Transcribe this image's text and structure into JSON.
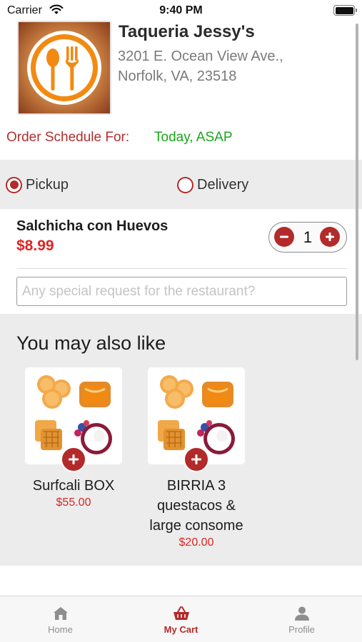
{
  "status_bar": {
    "carrier": "Carrier",
    "time": "9:40 PM"
  },
  "restaurant": {
    "name": "Taqueria Jessy's",
    "address_line1": "3201 E. Ocean View Ave.,",
    "address_line2": "Norfolk, VA, 23518"
  },
  "schedule": {
    "label": "Order Schedule For:",
    "value": "Today, ASAP"
  },
  "order_method": {
    "pickup_label": "Pickup",
    "delivery_label": "Delivery",
    "selected": "Pickup"
  },
  "cart_item": {
    "name": "Salchicha con Huevos",
    "price": "$8.99",
    "quantity": "1"
  },
  "special_request": {
    "placeholder": "Any special request for the restaurant?",
    "value": ""
  },
  "suggestions": {
    "title": "You may also like",
    "items": [
      {
        "name": "Surfcali BOX",
        "price": "$55.00"
      },
      {
        "name": "BIRRIA 3 questacos & large consome",
        "price": "$20.00"
      }
    ]
  },
  "tab_bar": {
    "items": [
      {
        "label": "Home",
        "icon": "home-icon"
      },
      {
        "label": "My Cart",
        "icon": "basket-icon",
        "active": true
      },
      {
        "label": "Profile",
        "icon": "person-icon"
      }
    ]
  },
  "colors": {
    "accent": "#b32a2a",
    "price": "#dd2525",
    "schedule_value": "#1aa51a",
    "band": "#ececec"
  }
}
